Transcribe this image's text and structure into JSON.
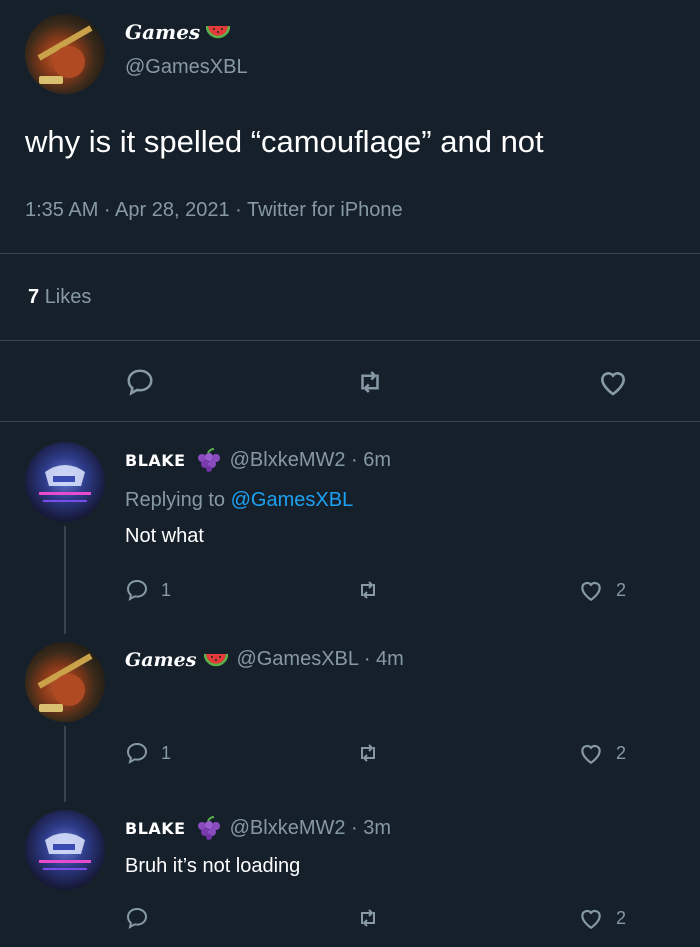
{
  "main_tweet": {
    "display_name": "Games",
    "name_emoji": "watermelon-icon",
    "handle": "@GamesXBL",
    "text": "why is it spelled “camouflage” and not",
    "meta": "1:35 AM · Apr 28, 2021 · Twitter for iPhone",
    "likes_count": "7",
    "likes_label": "Likes"
  },
  "replies": [
    {
      "display_name": "BLAKE",
      "name_emoji": "grapes-icon",
      "handle_time": "@BlxkeMW2 · 6m",
      "replying_prefix": "Replying to",
      "replying_handle": "@GamesXBL",
      "text": "Not what",
      "reply_count": "1",
      "like_count": "2"
    },
    {
      "display_name": "Games",
      "name_emoji": "watermelon-icon",
      "handle_time": "@GamesXBL · 4m",
      "text": "",
      "reply_count": "1",
      "like_count": "2"
    },
    {
      "display_name": "BLAKE",
      "name_emoji": "grapes-icon",
      "handle_time": "@BlxkeMW2 · 3m",
      "text": "Bruh it’s not loading",
      "reply_count": "",
      "like_count": "2"
    }
  ],
  "colors": {
    "background": "#15202b",
    "text": "#ffffff",
    "muted": "#8899a6",
    "link": "#1da1f2",
    "divider": "#38444d"
  }
}
